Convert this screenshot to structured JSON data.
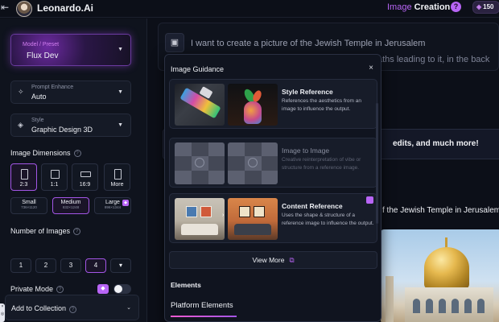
{
  "header": {
    "back_icon": "⇤",
    "brand": "Leonardo.Ai",
    "mode_a": "Image",
    "mode_b": "Creation",
    "help_icon": "?",
    "tokens": "150"
  },
  "sidebar": {
    "model": {
      "label": "Model / Preset",
      "value": "Flux Dev"
    },
    "enhance": {
      "label": "Prompt Enhance",
      "value": "Auto"
    },
    "style": {
      "label": "Style",
      "value": "Graphic Design 3D"
    },
    "dimensions": {
      "title": "Image Dimensions",
      "options": [
        "2:3",
        "1:1",
        "16:9",
        "More"
      ],
      "selected": "2:3"
    },
    "quality": [
      {
        "name": "Small",
        "size": "736×1120"
      },
      {
        "name": "Medium",
        "size": "832×1248"
      },
      {
        "name": "Large",
        "size": "896×1344"
      }
    ],
    "num_images": {
      "title": "Number of Images",
      "options": [
        "1",
        "2",
        "3",
        "4"
      ],
      "selected": "4",
      "more_icon": "▾"
    },
    "private_mode": {
      "label": "Private Mode",
      "enabled": false
    },
    "collection": {
      "label": "Add to Collection"
    }
  },
  "main": {
    "prompt_line1": "I want to create a picture of the Jewish Temple in Jerusalem",
    "prompt_line2": "aths leading to it, in the back",
    "banner_text": "edits, and much more!",
    "preview_caption": "f the Jewish Temple in Jerusalem"
  },
  "popup": {
    "title": "Image Guidance",
    "close_icon": "×",
    "options": [
      {
        "title": "Style Reference",
        "desc": "References the aesthetics from an image to influence the output."
      },
      {
        "title": "Image to Image",
        "desc": "Creative reinterpretation of vibe or structure from a reference image."
      },
      {
        "title": "Content Reference",
        "desc": "Uses the shape & structure of a reference image to influence the output."
      }
    ],
    "view_more": "View More",
    "view_more_icon": "⧉",
    "elements_heading": "Elements",
    "elements_tab": "Platform Elements"
  },
  "colors": {
    "accent": "#b865f5",
    "background": "#0c0f18",
    "panel": "#0f131d"
  }
}
